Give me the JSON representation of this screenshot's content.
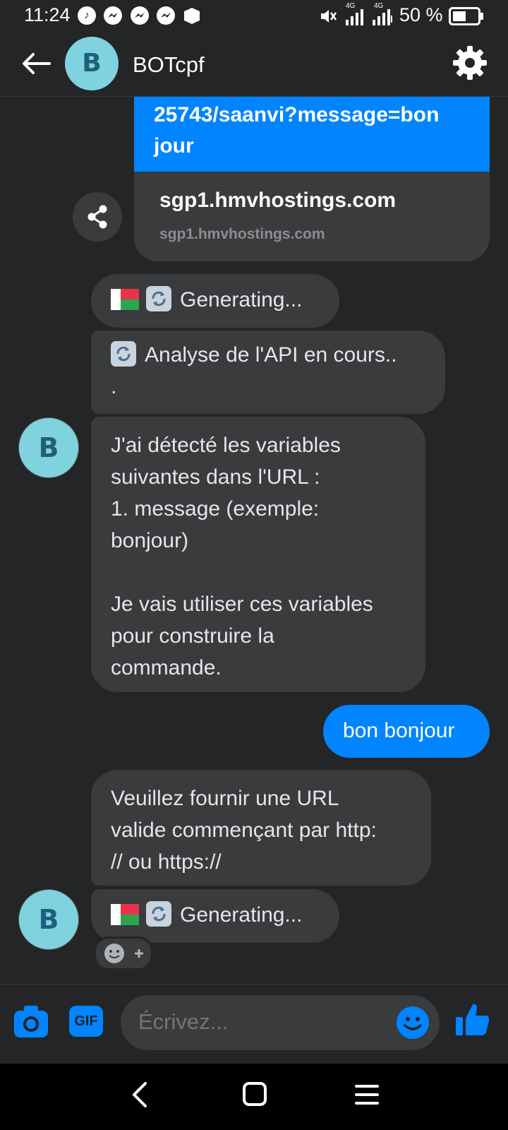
{
  "status_bar": {
    "time": "11:24",
    "network_1": "4G",
    "network_2": "4G",
    "battery_percent": "50 %"
  },
  "header": {
    "avatar_letter": "B",
    "title": "BOTcpf"
  },
  "messages": {
    "link_card": {
      "url_line_1": "25743/saanvi?message=bon",
      "url_line_2": "jour",
      "title": "sgp1.hmvhostings.com",
      "domain": "sgp1.hmvhostings.com"
    },
    "bot_generating_1": "Generating...",
    "bot_analyse_1": "Analyse de l'API en cours..",
    "bot_analyse_2": ".",
    "bot_variables": [
      "J'ai détecté les variables",
      "suivantes dans l'URL :",
      "1. message (exemple:",
      "bonjour)",
      "",
      "Je vais utiliser ces variables",
      "pour construire la",
      "commande."
    ],
    "user_message": "bon bonjour",
    "bot_url_error": [
      "Veuillez fournir une URL",
      "valide commençant par http:",
      "// ou https://"
    ],
    "bot_generating_2": "Generating...",
    "bot_avatar_letter": "B"
  },
  "composer": {
    "placeholder": "Écrivez...",
    "gif_label": "GIF"
  },
  "colors": {
    "background": "#242526",
    "bubble_incoming": "#3a3b3c",
    "accent": "#0084ff",
    "avatar": "#7fd3de"
  }
}
